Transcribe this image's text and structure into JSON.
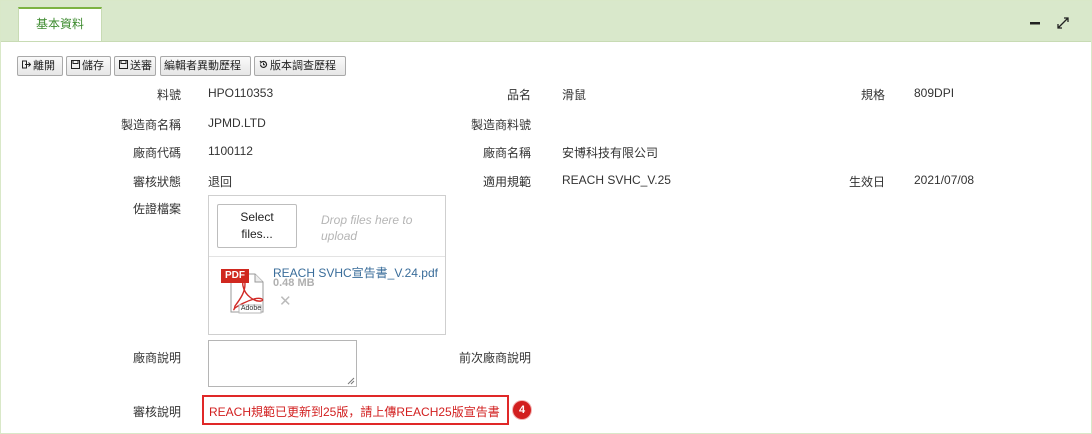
{
  "tab": {
    "label": "基本資料"
  },
  "toolbar": {
    "buttons": [
      {
        "label": "離開",
        "icon": "exit-icon"
      },
      {
        "label": "儲存",
        "icon": "save-icon"
      },
      {
        "label": "送審",
        "icon": "submit-icon"
      },
      {
        "label": "編輯者異動歷程",
        "icon": ""
      },
      {
        "label": "版本調查歷程",
        "icon": "history-icon"
      }
    ]
  },
  "form": {
    "part_no": {
      "label": "料號",
      "value": "HPO110353"
    },
    "product_name": {
      "label": "品名",
      "value": "滑鼠"
    },
    "spec": {
      "label": "規格",
      "value": "809DPI"
    },
    "manufacturer_name": {
      "label": "製造商名稱",
      "value": "JPMD.LTD"
    },
    "manufacturer_part_no": {
      "label": "製造商料號",
      "value": ""
    },
    "vendor_code": {
      "label": "廠商代碼",
      "value": "1100112"
    },
    "vendor_name": {
      "label": "廠商名稱",
      "value": "安博科技有限公司"
    },
    "review_status": {
      "label": "審核狀態",
      "value": "退回"
    },
    "applicable_regulation": {
      "label": "適用規範",
      "value": "REACH SVHC_V.25"
    },
    "effective_date": {
      "label": "生效日",
      "value": "2021/07/08"
    },
    "supporting_files": {
      "label": "佐證檔案",
      "select_line1": "Select",
      "select_line2": "files...",
      "drop_line1": "Drop files here to",
      "drop_line2": "upload",
      "file_name": "REACH SVHC宣告書_V.24.pdf",
      "file_size": "0.48 MB",
      "pdf_label": "PDF",
      "adobe_label": "Adobe"
    },
    "vendor_note": {
      "label": "廠商說明",
      "value": ""
    },
    "previous_vendor_note": {
      "label": "前次廠商說明",
      "value": ""
    },
    "review_note": {
      "label": "審核說明",
      "value": "REACH規範已更新到25版，請上傳REACH25版宣告書",
      "badge": "4"
    }
  },
  "colors": {
    "accent": "#7cb342",
    "tabbar": "#d9e8cb",
    "alert": "#e02828"
  }
}
